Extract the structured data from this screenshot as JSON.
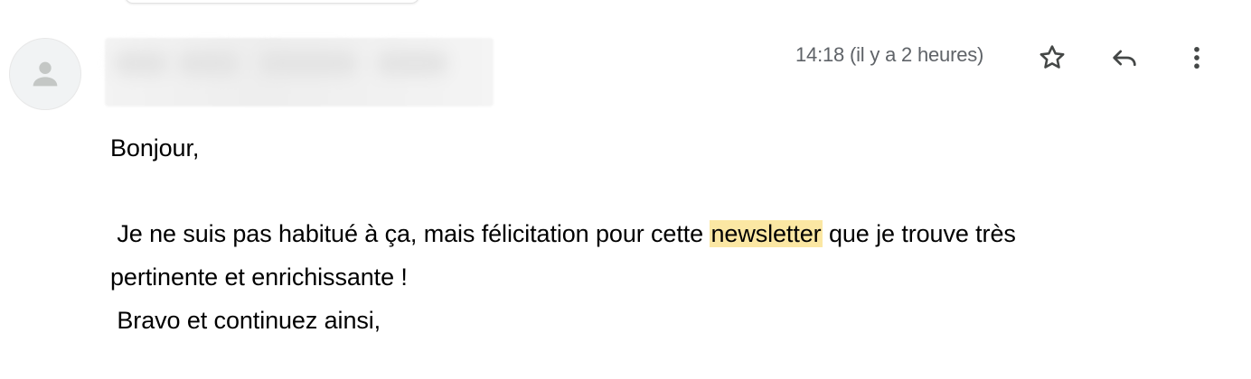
{
  "email": {
    "timestamp": "14:18 (il y a 2 heures)",
    "body": {
      "greeting": "Bonjour,",
      "line2_before": " Je ne suis pas habitué à ça, mais félicitation pour cette ",
      "line2_highlight": "newsletter",
      "line2_after": " que je trouve très",
      "line3": "pertinente et enrichissante !",
      "line4": " Bravo et continuez ainsi,"
    }
  },
  "icons": {
    "avatar": "person-icon",
    "star": "star-icon",
    "reply": "reply-icon",
    "more": "more-vert-icon"
  },
  "colors": {
    "highlight": "#fbe7a3",
    "icon": "#444746",
    "timestamp": "#5f6368"
  }
}
